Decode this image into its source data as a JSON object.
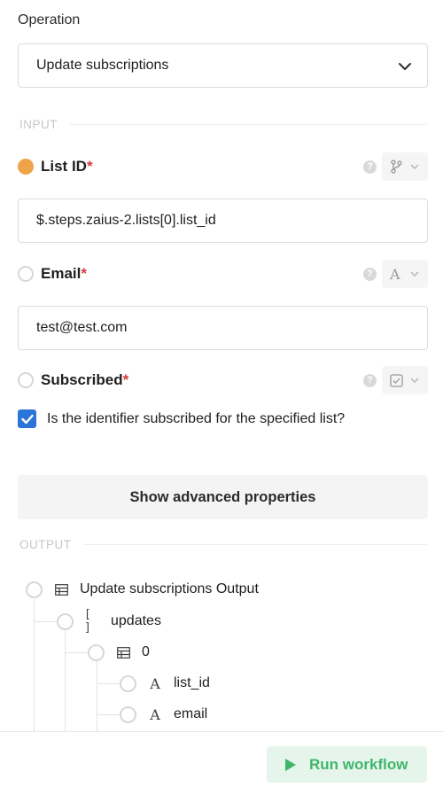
{
  "operation": {
    "label": "Operation",
    "selected": "Update subscriptions"
  },
  "input_section": {
    "label": "INPUT"
  },
  "fields": {
    "list_id": {
      "name": "List ID",
      "required_mark": "*",
      "value": "$.steps.zaius-2.lists[0].list_id",
      "type_icon": "branch-icon",
      "state": "active"
    },
    "email": {
      "name": "Email",
      "required_mark": "*",
      "value": "test@test.com",
      "type_icon": "text-type-icon",
      "type_glyph": "A"
    },
    "subscribed": {
      "name": "Subscribed",
      "required_mark": "*",
      "type_icon": "checkbox-type-icon",
      "checkbox_label": "Is the identifier subscribed for the specified list?",
      "checked": true
    }
  },
  "help_glyph": "?",
  "advanced_button": "Show advanced properties",
  "output_section": {
    "label": "OUTPUT"
  },
  "output_tree": {
    "root": {
      "label": "Update subscriptions Output",
      "icon": "table-icon"
    },
    "updates": {
      "label": "updates",
      "icon": "array-icon",
      "glyph": "[ ]"
    },
    "item0": {
      "label": "0",
      "icon": "table-icon"
    },
    "list_id": {
      "label": "list_id",
      "icon": "text-type-icon",
      "glyph": "A"
    },
    "email": {
      "label": "email",
      "icon": "text-type-icon",
      "glyph": "A"
    }
  },
  "run_button": "Run workflow",
  "colors": {
    "accent_orange": "#f0a44a",
    "required_red": "#d23c3c",
    "checkbox_blue": "#2b74d8",
    "run_green": "#3fb56a",
    "run_bg": "#e6f5ec"
  }
}
